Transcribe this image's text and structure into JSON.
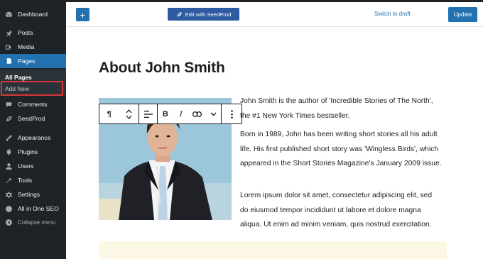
{
  "sidebar": {
    "items": [
      {
        "label": "Dashboard",
        "icon": "dashboard-icon"
      },
      {
        "label": "Posts",
        "icon": "pin-icon"
      },
      {
        "label": "Media",
        "icon": "media-icon"
      },
      {
        "label": "Pages",
        "icon": "pages-icon",
        "active": true
      },
      {
        "label": "Comments",
        "icon": "comment-icon"
      },
      {
        "label": "SeedProd",
        "icon": "seedprod-icon"
      },
      {
        "label": "Appearance",
        "icon": "brush-icon"
      },
      {
        "label": "Plugins",
        "icon": "plugin-icon"
      },
      {
        "label": "Users",
        "icon": "user-icon"
      },
      {
        "label": "Tools",
        "icon": "wrench-icon"
      },
      {
        "label": "Settings",
        "icon": "settings-icon"
      },
      {
        "label": "All in One SEO",
        "icon": "seo-icon"
      },
      {
        "label": "Collapse menu",
        "icon": "collapse-icon"
      }
    ],
    "submenu": {
      "all_pages": "All Pages",
      "add_new": "Add New"
    }
  },
  "toolbar": {
    "add_label": "+",
    "seedprod_label": "Edit with SeedProd",
    "draft_label": "Switch to draft",
    "update_label": "Update"
  },
  "block_toolbar": {
    "paragraph_symbol": "¶",
    "bold": "B",
    "italic": "I"
  },
  "content": {
    "title": "About John Smith",
    "paragraphs": [
      [
        "John Smith is the author of 'Incredible Stories of The North',",
        "the #1 New York Times bestseller."
      ],
      [
        "Born in 1989, John has been writing short stories all his adult",
        "life. His first published short story was 'Wingless Birds', which",
        "appeared in the Short Stories Magazine's January 2009 issue."
      ],
      [
        "Lorem ipsum dolor sit amet, consectetur adipiscing elit, sed",
        "do eiusmod tempor incididunt ut labore et dolore magna",
        "aliqua. Ut enim ad minim veniam, quis nostrud exercitation."
      ]
    ]
  },
  "colors": {
    "sidebar_bg": "#1d2327",
    "accent": "#2271b1",
    "highlight": "#d63638",
    "seedprod": "#2d5aa0"
  }
}
